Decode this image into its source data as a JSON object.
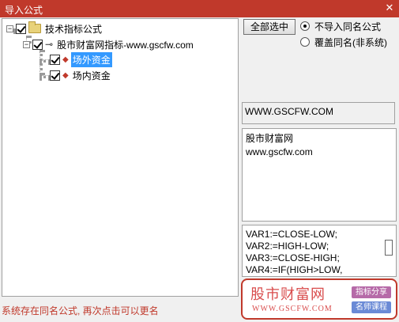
{
  "window": {
    "title": "导入公式",
    "close_glyph": "✕"
  },
  "tree": {
    "root": {
      "label": "技术指标公式",
      "expander": "−",
      "checked": true,
      "icon": "folder-icon"
    },
    "group": {
      "label": "股市财富网指标-www.gscfw.com",
      "expander": "−",
      "checked": true,
      "icon": "key-icon"
    },
    "items": [
      {
        "label": "场外资金",
        "checked": true,
        "selected": true,
        "icon": "diamond-icon"
      },
      {
        "label": "场内资金",
        "checked": true,
        "selected": false,
        "icon": "diamond-icon"
      }
    ]
  },
  "controls": {
    "select_all_label": "全部选中",
    "radio_options": [
      {
        "label": "不导入同名公式",
        "selected": true
      },
      {
        "label": "覆盖同名(非系统)",
        "selected": false
      }
    ]
  },
  "info": {
    "url_display": "WWW.GSCFW.COM",
    "description_lines": [
      "股市财富网",
      "www.gscfw.com"
    ],
    "code_lines": [
      "VAR1:=CLOSE-LOW;",
      "VAR2:=HIGH-LOW;",
      "VAR3:=CLOSE-HIGH;",
      "VAR4:=IF(HIGH>LOW,"
    ]
  },
  "status_text": "系统存在同名公式, 再次点击可以更名",
  "watermark": {
    "name": "股市财富网",
    "url": "WWW.GSCFW.COM",
    "tag1": "指标分享",
    "tag2": "名师课程"
  },
  "colors": {
    "title_bar": "#c0392b",
    "selection": "#3399ff",
    "status": "#c0392b"
  }
}
